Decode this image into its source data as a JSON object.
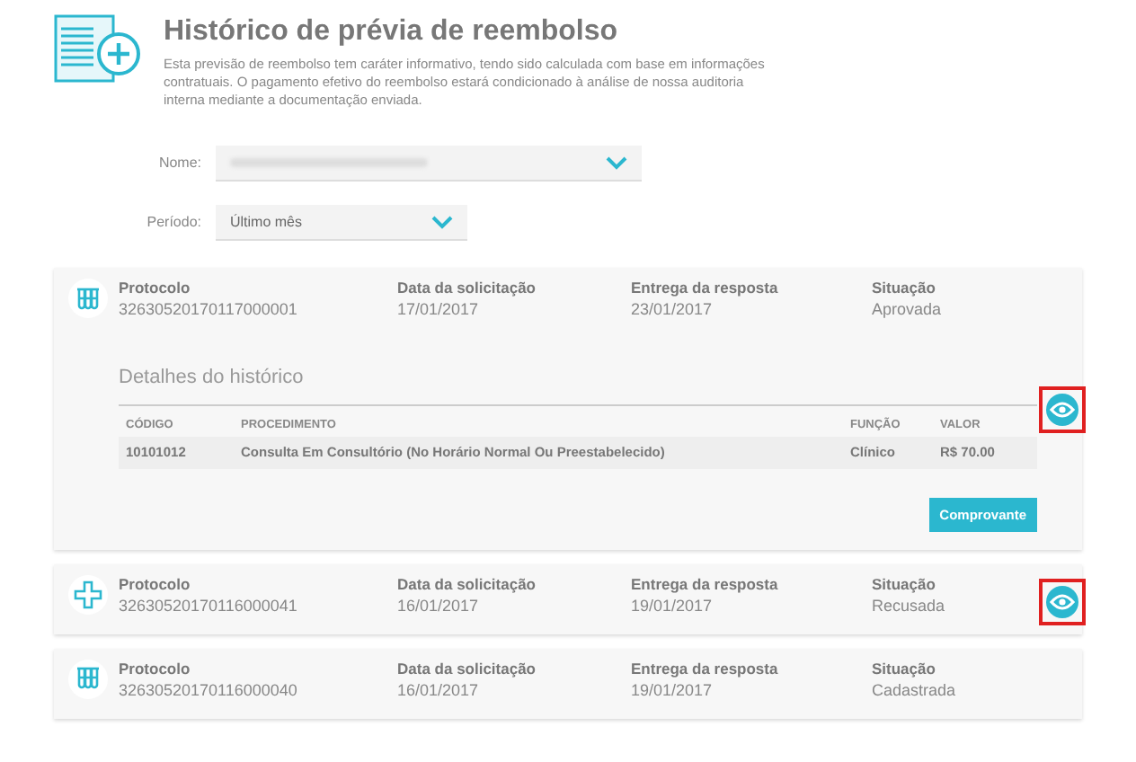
{
  "header": {
    "title": "Histórico de prévia de reembolso",
    "description": "Esta previsão de reembolso tem caráter informativo, tendo sido calculada com base em informações contratuais. O pagamento efetivo do reembolso estará condicionado à análise de nossa auditoria interna mediante a documentação enviada."
  },
  "filters": [
    {
      "label": "Nome:",
      "value_redacted": true
    },
    {
      "label": "Período:",
      "value": "Último mês"
    }
  ],
  "requests": [
    {
      "kind": "tubes",
      "fields": [
        {
          "label": "Protocolo",
          "value": "32630520170117000001"
        },
        {
          "label": "Data da solicitação",
          "value": "17/01/2017"
        },
        {
          "label": "Entrega da resposta",
          "value": "23/01/2017"
        },
        {
          "label": "Situação",
          "value": "Aprovada"
        }
      ],
      "expanded": true,
      "view_button": {
        "highlighted": true
      },
      "details": {
        "title": "Detalhes do histórico",
        "columns": [
          "CÓDIGO",
          "PROCEDIMENTO",
          "FUNÇÃO",
          "VALOR"
        ],
        "rows": [
          [
            "10101012",
            "Consulta Em Consultório (No Horário Normal Ou Preestabelecido)",
            "Clínico",
            "R$ 70.00"
          ]
        ],
        "button": "Comprovante"
      }
    },
    {
      "kind": "cross",
      "fields": [
        {
          "label": "Protocolo",
          "value": "32630520170116000041"
        },
        {
          "label": "Data da solicitação",
          "value": "16/01/2017"
        },
        {
          "label": "Entrega da resposta",
          "value": "19/01/2017"
        },
        {
          "label": "Situação",
          "value": "Recusada"
        }
      ],
      "expanded": false,
      "view_button": {
        "highlighted": true
      }
    },
    {
      "kind": "tubes",
      "fields": [
        {
          "label": "Protocolo",
          "value": "32630520170116000040"
        },
        {
          "label": "Data da solicitação",
          "value": "16/01/2017"
        },
        {
          "label": "Entrega da resposta",
          "value": "19/01/2017"
        },
        {
          "label": "Situação",
          "value": "Cadastrada"
        }
      ],
      "expanded": false
    }
  ]
}
